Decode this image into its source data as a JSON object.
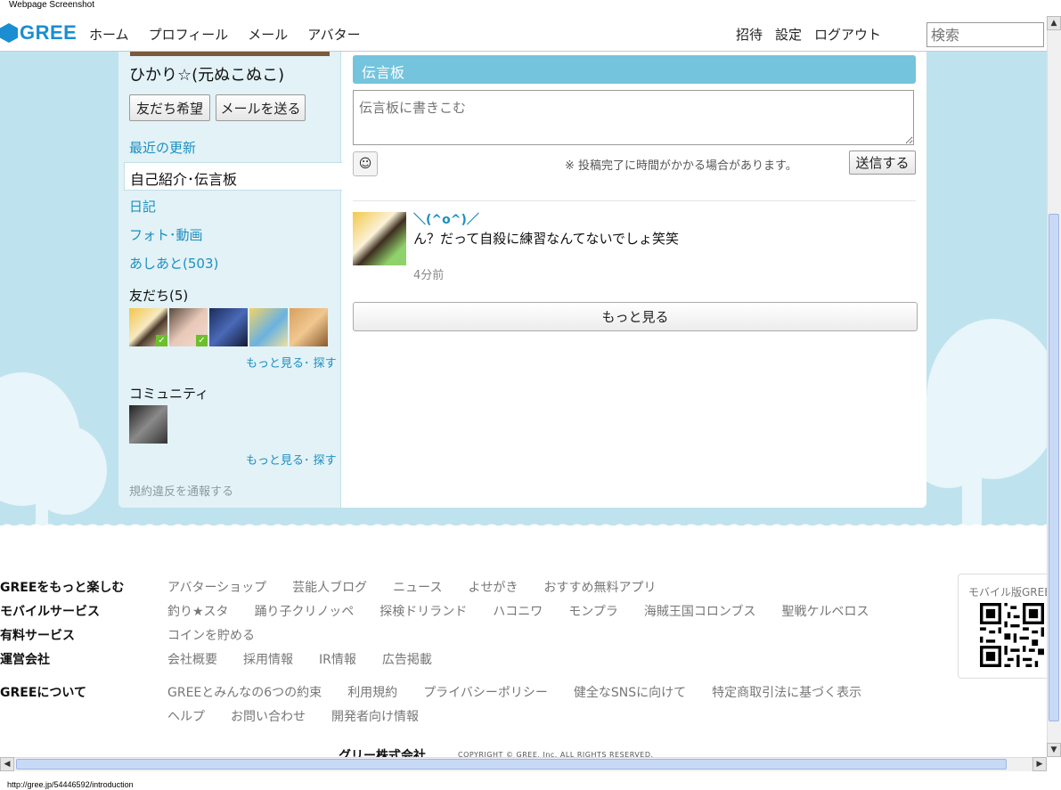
{
  "screenshot_label": "Webpage Screenshot",
  "brand": {
    "name": "GREE",
    "color": "#1a8ed0"
  },
  "nav": {
    "home": "ホーム",
    "profile": "プロフィール",
    "mail": "メール",
    "avatar": "アバター"
  },
  "nav_right": {
    "invite": "招待",
    "settings": "設定",
    "logout": "ログアウト"
  },
  "search": {
    "placeholder": "検索"
  },
  "profile": {
    "name": "ひかり☆(元ぬこぬこ)",
    "friend_request_label": "友だち希望",
    "send_mail_label": "メールを送る"
  },
  "sidebar": {
    "recent_updates": "最近の更新",
    "intro_board": "自己紹介･伝言板",
    "diary": "日記",
    "photo_video": "フォト･動画",
    "footprints": "あしあと(503)",
    "friends_heading": "友だち(5)",
    "friends_more": "もっと見る･ 探す",
    "community_heading": "コミュニティ",
    "community_more": "もっと見る･ 探す",
    "report": "規約違反を通報する"
  },
  "board": {
    "title": "伝言板",
    "input_placeholder": "伝言板に書きこむ",
    "notice": "※ 投稿完了に時間がかかる場合があります。",
    "send_label": "送信する",
    "more_label": "もっと見る"
  },
  "post": {
    "user": "＼(^o^)／",
    "text": "ん？だって自殺に練習なんてないでしょ笑笑",
    "time": "4分前"
  },
  "footer": {
    "rows": [
      {
        "heading": "GREEをもっと楽しむ",
        "links": [
          "アバターショップ",
          "芸能人ブログ",
          "ニュース",
          "よせがき",
          "おすすめ無料アプリ"
        ]
      },
      {
        "heading": "モバイルサービス",
        "links": [
          "釣り★スタ",
          "踊り子クリノッペ",
          "探検ドリランド",
          "ハコニワ",
          "モンプラ",
          "海賊王国コロンブス",
          "聖戦ケルベロス"
        ]
      },
      {
        "heading": "有料サービス",
        "links": [
          "コインを貯める"
        ]
      },
      {
        "heading": "運営会社",
        "links": [
          "会社概要",
          "採用情報",
          "IR情報",
          "広告掲載"
        ]
      },
      {
        "heading": "GREEについて",
        "links": [
          "GREEとみんなの6つの約束",
          "利用規約",
          "プライバシーポリシー",
          "健全なSNSに向けて",
          "特定商取引法に基づく表示"
        ]
      },
      {
        "heading": "",
        "links": [
          "ヘルプ",
          "お問い合わせ",
          "開発者向け情報"
        ]
      }
    ],
    "qr_title": "モバイル版GREE",
    "company": "グリー株式会社",
    "copyright": "COPYRIGHT © GREE, Inc. ALL RIGHTS RESERVED."
  },
  "status_url": "http://gree.jp/54446592/introduction"
}
